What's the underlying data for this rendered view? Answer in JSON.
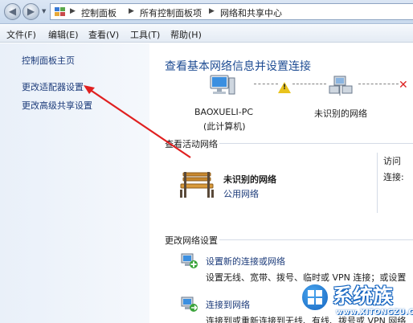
{
  "address": {
    "crumbs": [
      "控制面板",
      "所有控制面板项",
      "网络和共享中心"
    ]
  },
  "menu": {
    "items": [
      "文件(F)",
      "编辑(E)",
      "查看(V)",
      "工具(T)",
      "帮助(H)"
    ]
  },
  "sidebar": {
    "items": [
      "控制面板主页",
      "更改适配器设置",
      "更改高级共享设置"
    ]
  },
  "main": {
    "title": "查看基本网络信息并设置连接",
    "map": {
      "computer_name": "BAOXUELI-PC",
      "computer_sub": "(此计算机)",
      "network_label": "未识别的网络"
    },
    "active_section": "查看活动网络",
    "network": {
      "name": "未识别的网络",
      "type": "公用网络",
      "access_label": "访问",
      "connect_label": "连接:"
    },
    "change_section": "更改网络设置",
    "tasks": [
      {
        "label": "设置新的连接或网络",
        "desc": "设置无线、宽带、拨号、临时或 VPN 连接；或设置"
      },
      {
        "label": "连接到网络",
        "desc": "连接到或重新连接到无线、有线、拨号或 VPN 网络"
      }
    ]
  },
  "watermark": {
    "text": "系统族",
    "url": "www.XITONGZU.COM"
  },
  "colors": {
    "link": "#1c3b7a",
    "title": "#1e4c93",
    "arrow": "#e02020",
    "warning": "#e9c31c"
  }
}
